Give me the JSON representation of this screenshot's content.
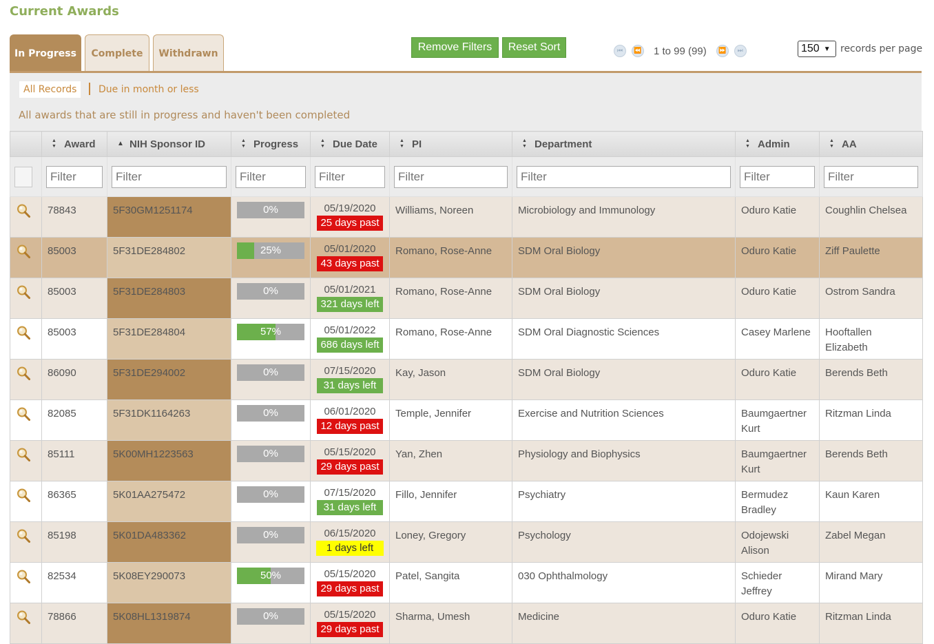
{
  "page": {
    "title": "Current Awards"
  },
  "tabs": [
    {
      "label": "In Progress",
      "active": true
    },
    {
      "label": "Complete",
      "active": false
    },
    {
      "label": "Withdrawn",
      "active": false
    }
  ],
  "toolbar": {
    "remove_filters": "Remove Filters",
    "reset_sort": "Reset Sort"
  },
  "pager": {
    "range": "1 to 99 (99)",
    "records_per_page": "150",
    "records_per_page_label": "records per page"
  },
  "quick_filters": {
    "all": "All Records",
    "due": "Due in month or less"
  },
  "description": "All awards that are still in progress and haven't been completed",
  "columns": [
    {
      "label": "",
      "sort": ""
    },
    {
      "label": "Award",
      "sort": "both"
    },
    {
      "label": "NIH Sponsor ID",
      "sort": "asc"
    },
    {
      "label": "Progress",
      "sort": "both"
    },
    {
      "label": "Due Date",
      "sort": "both"
    },
    {
      "label": "PI",
      "sort": "both"
    },
    {
      "label": "Department",
      "sort": "both"
    },
    {
      "label": "Admin",
      "sort": "both"
    },
    {
      "label": "AA",
      "sort": "both"
    }
  ],
  "filter_placeholder": "Filter",
  "colors": {
    "accent": "#b48c5a",
    "green": "#6cb04c",
    "red": "#dd1111",
    "yellow": "#ffff00",
    "title": "#8fae5b"
  },
  "rows": [
    {
      "award": "78843",
      "sponsor": "5F30GM1251174",
      "progress": 0,
      "progress_label": "0%",
      "due_date": "05/19/2020",
      "due_status": "25 days past",
      "due_type": "past",
      "pi": "Williams, Noreen",
      "department": "Microbiology and Immunology",
      "admin": "Oduro Katie",
      "aa": "Coughlin Chelsea"
    },
    {
      "award": "85003",
      "sponsor": "5F31DE284802",
      "progress": 25,
      "progress_label": "25%",
      "due_date": "05/01/2020",
      "due_status": "43 days past",
      "due_type": "past",
      "pi": "Romano, Rose-Anne",
      "department": "SDM Oral Biology",
      "admin": "Oduro Katie",
      "aa": "Ziff Paulette",
      "highlight": true
    },
    {
      "award": "85003",
      "sponsor": "5F31DE284803",
      "progress": 0,
      "progress_label": "0%",
      "due_date": "05/01/2021",
      "due_status": "321 days left",
      "due_type": "left",
      "pi": "Romano, Rose-Anne",
      "department": "SDM Oral Biology",
      "admin": "Oduro Katie",
      "aa": "Ostrom Sandra"
    },
    {
      "award": "85003",
      "sponsor": "5F31DE284804",
      "progress": 57,
      "progress_label": "57%",
      "due_date": "05/01/2022",
      "due_status": "686 days left",
      "due_type": "left",
      "pi": "Romano, Rose-Anne",
      "department": "SDM Oral Diagnostic Sciences",
      "admin": "Casey Marlene",
      "aa": "Hooftallen Elizabeth"
    },
    {
      "award": "86090",
      "sponsor": "5F31DE294002",
      "progress": 0,
      "progress_label": "0%",
      "due_date": "07/15/2020",
      "due_status": "31 days left",
      "due_type": "left",
      "pi": "Kay, Jason",
      "department": "SDM Oral Biology",
      "admin": "Oduro Katie",
      "aa": "Berends Beth"
    },
    {
      "award": "82085",
      "sponsor": "5F31DK1164263",
      "progress": 0,
      "progress_label": "0%",
      "due_date": "06/01/2020",
      "due_status": "12 days past",
      "due_type": "past",
      "pi": "Temple, Jennifer",
      "department": "Exercise and Nutrition Sciences",
      "admin": "Baumgaertner Kurt",
      "aa": "Ritzman Linda"
    },
    {
      "award": "85111",
      "sponsor": "5K00MH1223563",
      "progress": 0,
      "progress_label": "0%",
      "due_date": "05/15/2020",
      "due_status": "29 days past",
      "due_type": "past",
      "pi": "Yan, Zhen",
      "department": "Physiology and Biophysics",
      "admin": "Baumgaertner Kurt",
      "aa": "Berends Beth"
    },
    {
      "award": "86365",
      "sponsor": "5K01AA275472",
      "progress": 0,
      "progress_label": "0%",
      "due_date": "07/15/2020",
      "due_status": "31 days left",
      "due_type": "left",
      "pi": "Fillo, Jennifer",
      "department": "Psychiatry",
      "admin": "Bermudez Bradley",
      "aa": "Kaun Karen"
    },
    {
      "award": "85198",
      "sponsor": "5K01DA483362",
      "progress": 0,
      "progress_label": "0%",
      "due_date": "06/15/2020",
      "due_status": "1 days left",
      "due_type": "warn",
      "pi": "Loney, Gregory",
      "department": "Psychology",
      "admin": "Odojewski Alison",
      "aa": "Zabel Megan"
    },
    {
      "award": "82534",
      "sponsor": "5K08EY290073",
      "progress": 50,
      "progress_label": "50%",
      "due_date": "05/15/2020",
      "due_status": "29 days past",
      "due_type": "past",
      "pi": "Patel, Sangita",
      "department": "030 Ophthalmology",
      "admin": "Schieder Jeffrey",
      "aa": "Mirand Mary"
    },
    {
      "award": "78866",
      "sponsor": "5K08HL1319874",
      "progress": 0,
      "progress_label": "0%",
      "due_date": "05/15/2020",
      "due_status": "29 days past",
      "due_type": "past",
      "pi": "Sharma, Umesh",
      "department": "Medicine",
      "admin": "Oduro Katie",
      "aa": "Ritzman Linda"
    }
  ]
}
